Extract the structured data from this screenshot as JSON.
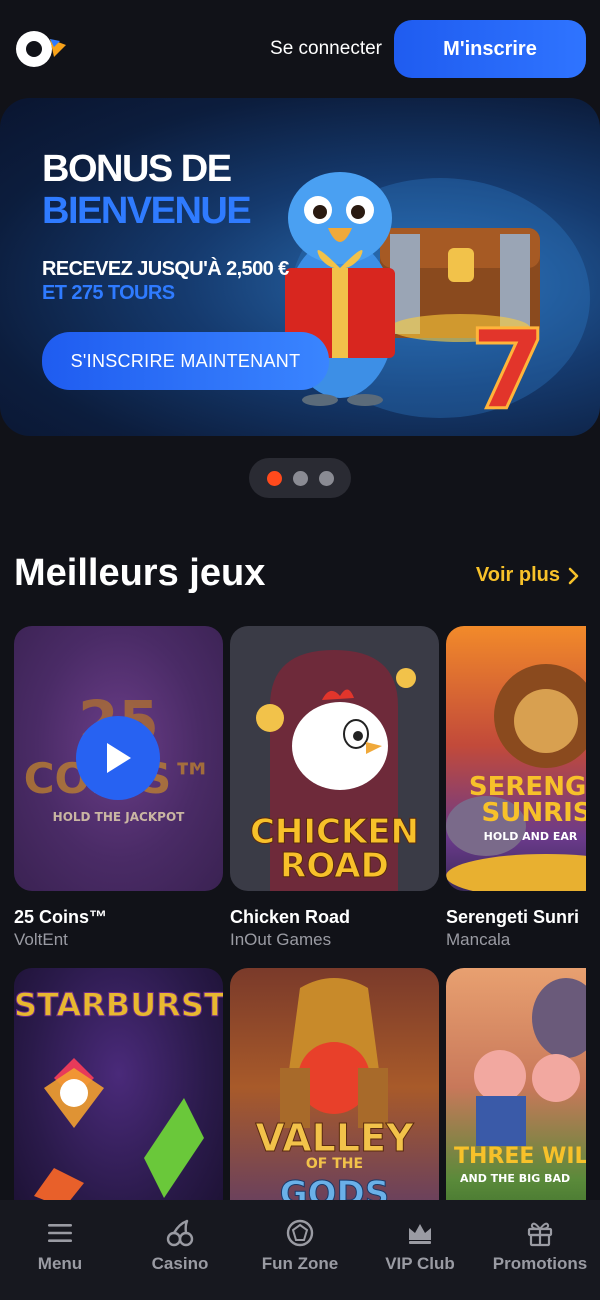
{
  "header": {
    "login_label": "Se connecter",
    "signup_label": "M'inscrire"
  },
  "banner": {
    "title_line1": "BONUS DE",
    "title_line2": "BIENVENUE",
    "offer_line1": "RECEVEZ JUSQU'À 2,500 €",
    "offer_line2": "ET 275 TOURS",
    "cta_label": "S'INSCRIRE MAINTENANT",
    "slide_count": 3,
    "active_slide": 1
  },
  "section": {
    "title": "Meilleurs jeux",
    "see_more_label": "Voir plus"
  },
  "games": [
    {
      "name": "25 Coins™",
      "provider": "VoltEnt",
      "art_line1": "25",
      "art_line2": "COINS™",
      "art_line3": "HOLD THE JACKPOT"
    },
    {
      "name": "Chicken Road",
      "provider": "InOut Games",
      "art_line1": "CHICKEN",
      "art_line2": "ROAD"
    },
    {
      "name": "Serengeti Sunri",
      "provider": "Mancala",
      "art_line1": "SERENGE",
      "art_line2": "SUNRIS",
      "art_line3": "HOLD AND EAR"
    },
    {
      "art_line1": "STARBURST"
    },
    {
      "art_line1": "VALLEY",
      "art_line2": "OF THE",
      "art_line3": "GODS"
    },
    {
      "art_line1": "THREE WILD",
      "art_line2": "AND THE BIG BAD"
    }
  ],
  "bottom_nav": [
    {
      "label": "Menu",
      "icon": "menu-icon"
    },
    {
      "label": "Casino",
      "icon": "cherry-icon"
    },
    {
      "label": "Fun Zone",
      "icon": "gem-icon"
    },
    {
      "label": "VIP Club",
      "icon": "crown-icon"
    },
    {
      "label": "Promotions",
      "icon": "gift-icon"
    }
  ],
  "colors": {
    "background": "#111218",
    "accent_blue": "#2762f2",
    "accent_yellow": "#f7c12a",
    "dot_active": "#ff4a1c"
  }
}
